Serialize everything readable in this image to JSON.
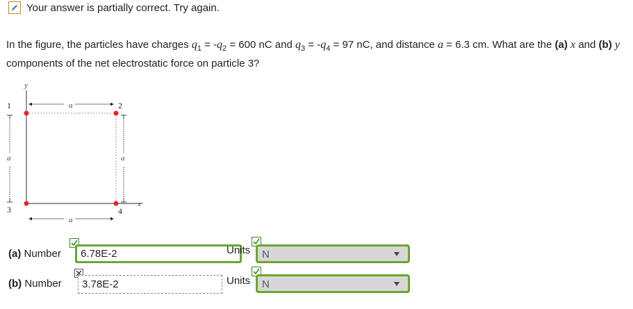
{
  "status": {
    "text": "Your answer is partially correct.  Try again."
  },
  "question": {
    "p1": "In the figure, the particles have charges ",
    "q1": "q",
    "s1": "1",
    "eq1": " = -",
    "q2": "q",
    "s2": "2",
    "eq2": " = 600 nC and ",
    "q3": "q",
    "s3": "3",
    "eq3": " = -",
    "q4": "q",
    "s4": "4",
    "eq4": " = 97 nC, and distance ",
    "a": "a",
    "eq5": " = 6.3 cm. What are the ",
    "pa": "(a)",
    "x": "x",
    "and": " and ",
    "pb": "(b)",
    "y": "y",
    "tail": " components of the net electrostatic force on particle 3?"
  },
  "figure": {
    "y_axis": "y",
    "x_axis": "x",
    "a_label": "a",
    "p1": "1",
    "p2": "2",
    "p3": "3",
    "p4": "4"
  },
  "answers": [
    {
      "label": "(a)",
      "number_label": "Number",
      "value": "6.78E-2",
      "value_status": "correct",
      "units_label": "Units",
      "units": "N",
      "units_status": "correct"
    },
    {
      "label": "(b)",
      "number_label": "Number",
      "value": "3.78E-2",
      "value_status": "incorrect",
      "units_label": "Units",
      "units": "N",
      "units_status": "correct"
    }
  ],
  "colors": {
    "correct": "#6aa62e",
    "status_icon": "#e07a10",
    "particle": "#e8212a"
  }
}
